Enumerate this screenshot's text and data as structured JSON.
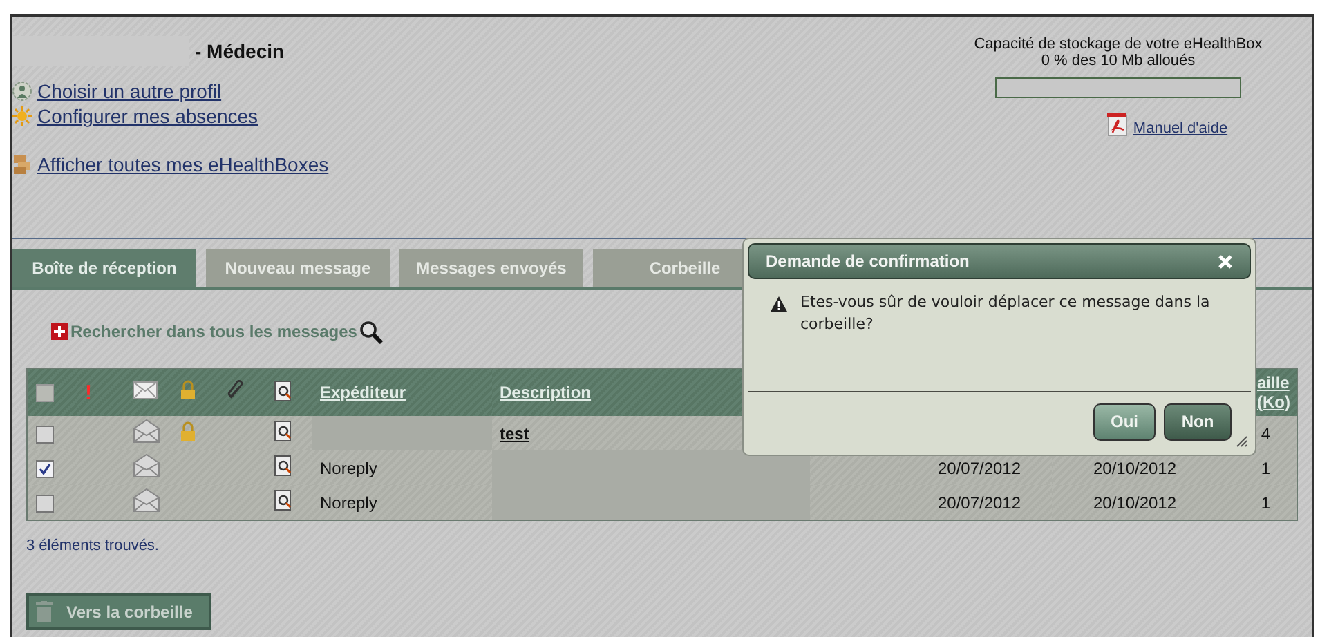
{
  "header": {
    "role": "- Médecin",
    "links": [
      {
        "label": "Choisir un autre profil"
      },
      {
        "label": "Configurer mes absences"
      },
      {
        "label": "Afficher toutes mes eHealthBoxes"
      }
    ]
  },
  "storage": {
    "title": "Capacité de stockage de votre eHealthBox",
    "usage": "0 % des 10 Mb alloués",
    "level": 0
  },
  "help_link": "Manuel d'aide",
  "tabs": [
    {
      "label": "Boîte de réception",
      "selected": true
    },
    {
      "label": "Nouveau message",
      "selected": false
    },
    {
      "label": "Messages envoyés",
      "selected": false
    },
    {
      "label": "Corbeille",
      "selected": false
    }
  ],
  "search_link": "Rechercher dans tous les messages",
  "table": {
    "all_selected": false,
    "priority_mark": "!",
    "columns": [
      "Expéditeur",
      "Description"
    ],
    "size_column": "aille (Ko)",
    "rows": [
      {
        "checked": false,
        "locked": true,
        "sender": "",
        "sender_redacted": true,
        "description": "test",
        "description_redacted": false,
        "date_1": "",
        "date_2": "",
        "size": "4"
      },
      {
        "checked": true,
        "locked": false,
        "sender": "Noreply",
        "sender_redacted": false,
        "description": "",
        "description_redacted": true,
        "date_1": "20/07/2012",
        "date_2": "20/10/2012",
        "size": "1"
      },
      {
        "checked": false,
        "locked": false,
        "sender": "Noreply",
        "sender_redacted": false,
        "description": "",
        "description_redacted": true,
        "date_1": "20/07/2012",
        "date_2": "20/10/2012",
        "size": "1"
      }
    ]
  },
  "result_count": "3 éléments trouvés.",
  "trash_button": "Vers la corbeille",
  "dialog": {
    "title": "Demande de confirmation",
    "message": "Etes-vous sûr de vouloir déplacer ce message dans la corbeille?",
    "buttons": [
      {
        "label": "Oui",
        "kind": "primary"
      },
      {
        "label": "Non",
        "kind": "secondary"
      }
    ]
  }
}
